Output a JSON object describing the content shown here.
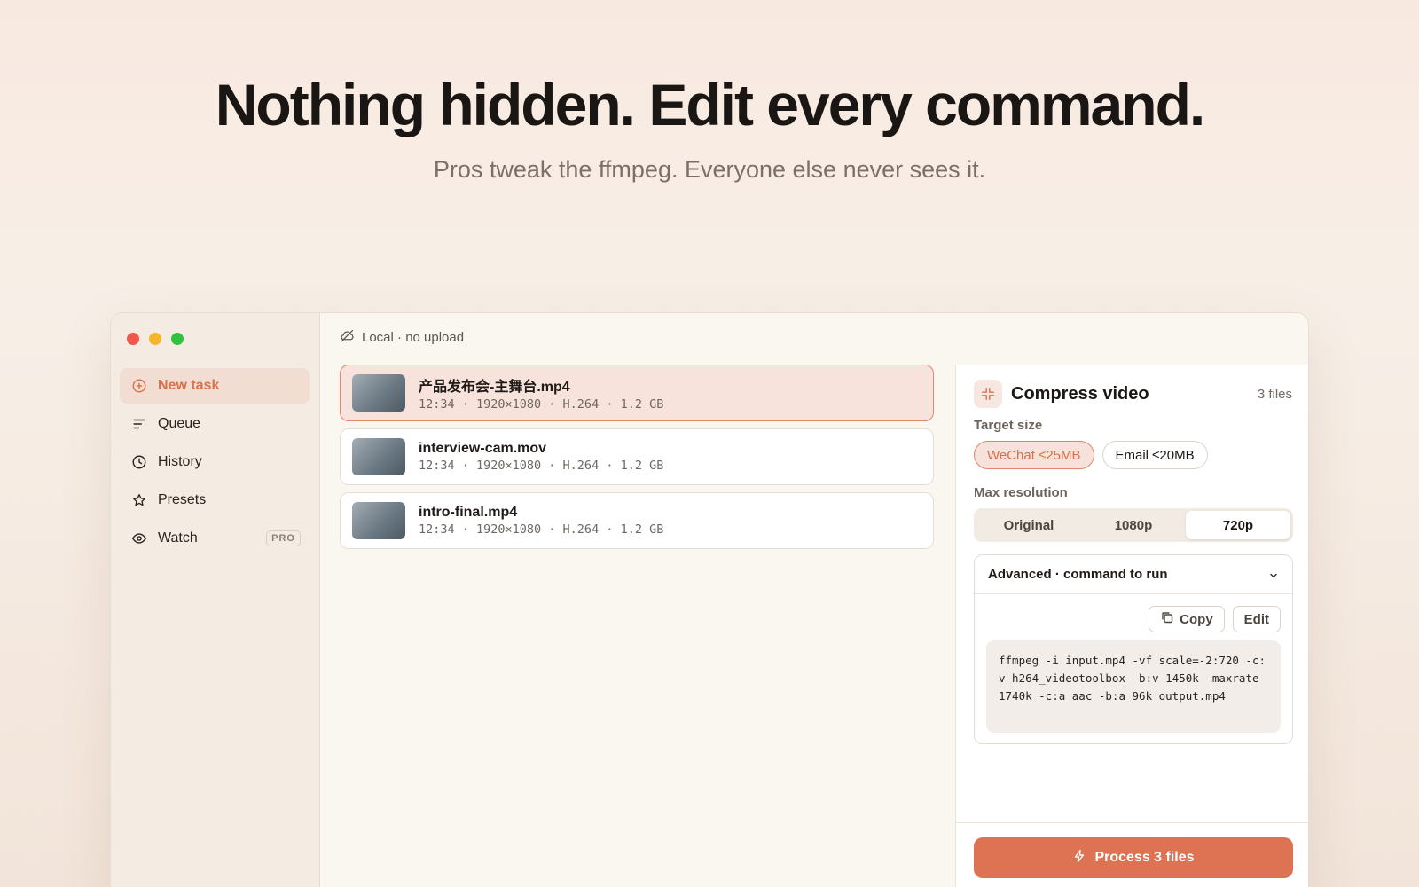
{
  "hero": {
    "title": "Nothing hidden. Edit every command.",
    "subtitle": "Pros tweak the ffmpeg. Everyone else never sees it."
  },
  "sidebar": {
    "items": [
      {
        "label": "New task",
        "icon": "plus-circle-icon"
      },
      {
        "label": "Queue",
        "icon": "list-icon"
      },
      {
        "label": "History",
        "icon": "clock-icon"
      },
      {
        "label": "Presets",
        "icon": "star-icon"
      },
      {
        "label": "Watch",
        "icon": "eye-icon",
        "badge": "PRO"
      }
    ]
  },
  "topbar": {
    "status": "Local · no upload"
  },
  "files": [
    {
      "name": "产品发布会-主舞台.mp4",
      "meta": "12:34 · 1920×1080 · H.264 · 1.2 GB"
    },
    {
      "name": "interview-cam.mov",
      "meta": "12:34 · 1920×1080 · H.264 · 1.2 GB"
    },
    {
      "name": "intro-final.mp4",
      "meta": "12:34 · 1920×1080 · H.264 · 1.2 GB"
    }
  ],
  "panel": {
    "title": "Compress video",
    "count": "3 files",
    "target_label": "Target size",
    "targets": [
      "WeChat ≤25MB",
      "Email ≤20MB"
    ],
    "resolution_label": "Max resolution",
    "resolutions": [
      "Original",
      "1080p",
      "720p"
    ],
    "advanced_label": "Advanced · command to run",
    "copy_label": "Copy",
    "edit_label": "Edit",
    "command": "ffmpeg -i input.mp4 -vf scale=-2:720 -c:v h264_videotoolbox -b:v 1450k -maxrate 1740k -c:a aac -b:a 96k output.mp4",
    "process_label": "Process 3 files"
  },
  "colors": {
    "accent": "#dd7352",
    "accent_soft": "#f6e2da",
    "traffic_red": "#f0574d",
    "traffic_yellow": "#f5b52e",
    "traffic_green": "#33c23f"
  }
}
